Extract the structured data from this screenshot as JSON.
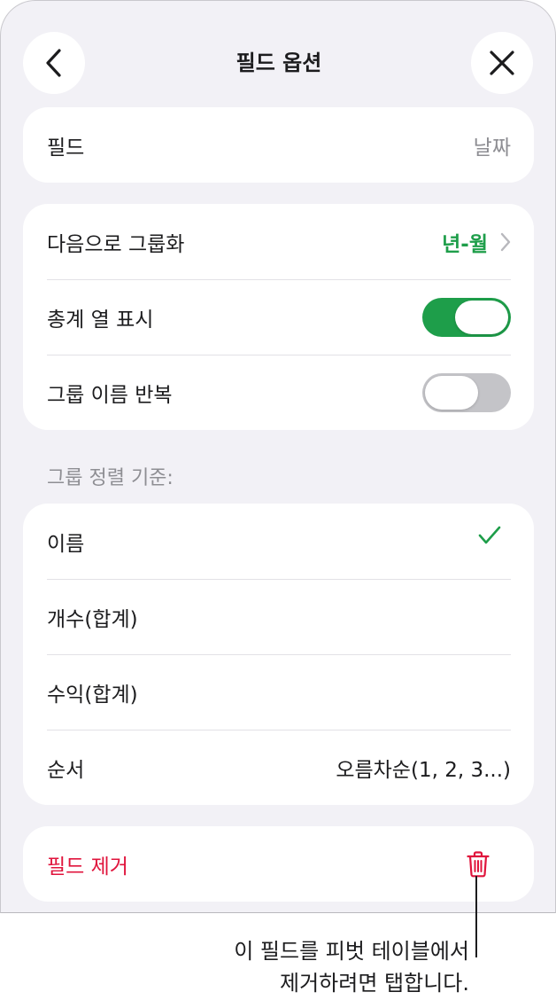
{
  "header": {
    "title": "필드 옵션",
    "back_icon": "chevron-left-icon",
    "close_icon": "close-icon"
  },
  "field_card": {
    "label": "필드",
    "value": "날짜"
  },
  "group_card": {
    "group_by": {
      "label": "다음으로 그룹화",
      "value": "년-월"
    },
    "show_totals": {
      "label": "총계 열 표시",
      "on": true
    },
    "repeat_names": {
      "label": "그룹 이름 반복",
      "on": false
    }
  },
  "sort_section": {
    "header": "그룹 정렬 기준:",
    "items": [
      {
        "label": "이름",
        "checked": true
      },
      {
        "label": "개수(합계)"
      },
      {
        "label": "수익(합계)"
      },
      {
        "label": "순서",
        "value": "오름차순(1, 2, 3...)"
      }
    ]
  },
  "remove": {
    "label": "필드 제거",
    "icon": "trash-icon"
  },
  "callout": {
    "line1": "이 필드를 피벗 테이블에서",
    "line2": "제거하려면 탭합니다."
  },
  "colors": {
    "accent_green": "#1e9e4a",
    "destructive_red": "#e0143c",
    "background": "#f2f1f6"
  }
}
